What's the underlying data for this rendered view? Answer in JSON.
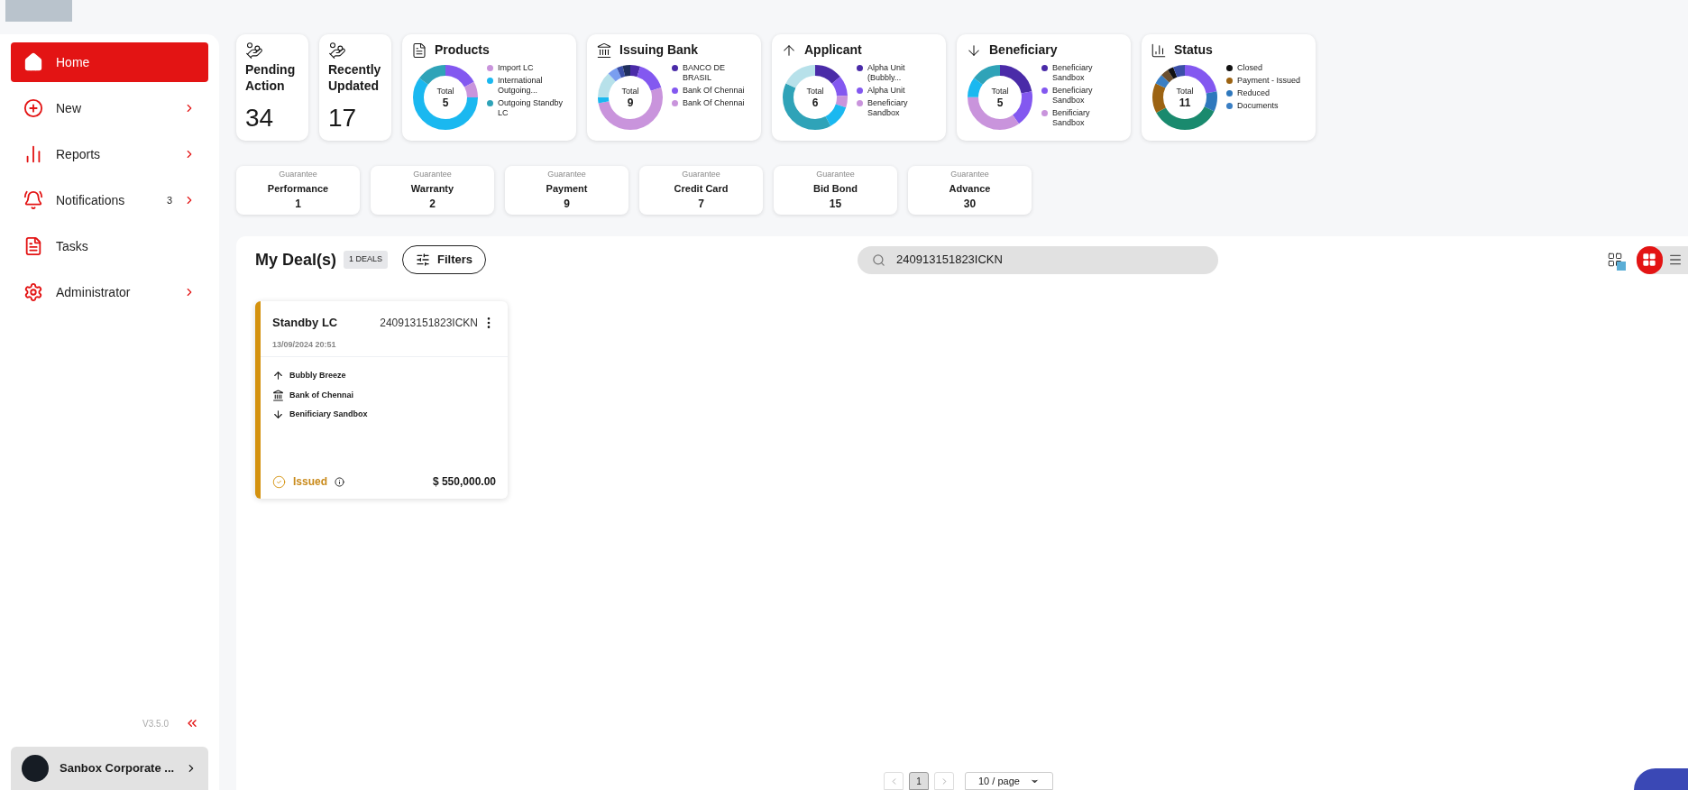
{
  "sidebar": {
    "items": [
      {
        "label": "Home",
        "selected": true,
        "has_submenu": false
      },
      {
        "label": "New",
        "selected": false,
        "has_submenu": true
      },
      {
        "label": "Reports",
        "selected": false,
        "has_submenu": true
      },
      {
        "label": "Notifications",
        "selected": false,
        "has_submenu": true,
        "badge": "3"
      },
      {
        "label": "Tasks",
        "selected": false,
        "has_submenu": false
      },
      {
        "label": "Administrator",
        "selected": false,
        "has_submenu": true
      }
    ],
    "version": "V3.5.0",
    "account": "Sanbox Corporate ..."
  },
  "summary_cards": [
    {
      "kind": "count",
      "title": "Pending Action",
      "value": "34"
    },
    {
      "kind": "count",
      "title": "Recently Updated",
      "value": "17"
    },
    {
      "kind": "donut",
      "title": "Products",
      "total_label": "Total",
      "total": "5",
      "legend": [
        {
          "label": "Import LC",
          "color": "#c994dc"
        },
        {
          "label": "International Outgoing...",
          "color": "#1ab8f0"
        },
        {
          "label": "Outgoing Standby LC",
          "color": "#2fa3b8"
        }
      ]
    },
    {
      "kind": "donut",
      "title": "Issuing Bank",
      "total_label": "Total",
      "total": "9",
      "legend": [
        {
          "label": "BANCO DE BRASIL",
          "color": "#4a2ba8"
        },
        {
          "label": "Bank Of Chennai",
          "color": "#8358f0"
        },
        {
          "label": "Bank Of Chennai",
          "color": "#c994dc"
        }
      ]
    },
    {
      "kind": "donut",
      "title": "Applicant",
      "total_label": "Total",
      "total": "6",
      "legend": [
        {
          "label": "Alpha Unit (Bubbly...",
          "color": "#4a2ba8"
        },
        {
          "label": "Alpha Unit",
          "color": "#8358f0"
        },
        {
          "label": "Beneficiary Sandbox",
          "color": "#c994dc"
        }
      ]
    },
    {
      "kind": "donut",
      "title": "Beneficiary",
      "total_label": "Total",
      "total": "5",
      "legend": [
        {
          "label": "Beneficiary Sandbox",
          "color": "#4a2ba8"
        },
        {
          "label": "Beneficiary Sandbox",
          "color": "#8358f0"
        },
        {
          "label": "Benificiary Sandbox",
          "color": "#c994dc"
        }
      ]
    },
    {
      "kind": "donut",
      "title": "Status",
      "total_label": "Total",
      "total": "11",
      "legend": [
        {
          "label": "Closed",
          "color": "#111111"
        },
        {
          "label": "Payment - Issued",
          "color": "#9c6312"
        },
        {
          "label": "Reduced",
          "color": "#2f78bd"
        },
        {
          "label": "Documents",
          "color": "#3a7fc4"
        }
      ]
    }
  ],
  "guarantees": [
    {
      "caption": "Guarantee",
      "name": "Performance",
      "count": "1"
    },
    {
      "caption": "Guarantee",
      "name": "Warranty",
      "count": "2"
    },
    {
      "caption": "Guarantee",
      "name": "Payment",
      "count": "9"
    },
    {
      "caption": "Guarantee",
      "name": "Credit Card",
      "count": "7"
    },
    {
      "caption": "Guarantee",
      "name": "Bid Bond",
      "count": "15"
    },
    {
      "caption": "Guarantee",
      "name": "Advance",
      "count": "30"
    }
  ],
  "deals": {
    "title": "My Deal(s)",
    "count_badge": "1 DEALS",
    "filters_button": "Filters",
    "search": {
      "value": "240913151823ICKN"
    },
    "view_modes": [
      {
        "kind": "grid",
        "selected": true
      },
      {
        "kind": "list",
        "selected": false
      }
    ],
    "cards": [
      {
        "product": "Standby LC",
        "reference": "240913151823ICKN",
        "date": "13/09/2024 20:51",
        "applicant": "Bubbly Breeze",
        "bank": "Bank of Chennai",
        "beneficiary": "Benificiary Sandbox",
        "status": "Issued",
        "amount": "$ 550,000.00"
      }
    ]
  },
  "pagination": {
    "pages": [
      {
        "label": "1",
        "selected": true
      }
    ],
    "page_size": "10 / page"
  }
}
